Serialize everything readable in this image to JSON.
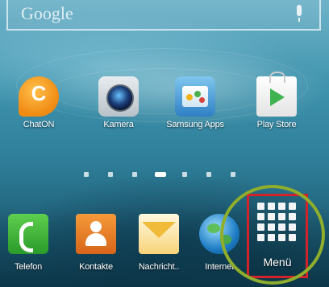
{
  "search": {
    "logo_text": "Google",
    "mic_icon": "microphone-icon"
  },
  "home_apps": [
    {
      "label": "ChatON",
      "icon": "chaton-icon"
    },
    {
      "label": "Kamera",
      "icon": "camera-icon"
    },
    {
      "label": "Samsung Apps",
      "icon": "samsung-apps-icon"
    },
    {
      "label": "Play Store",
      "icon": "play-store-icon"
    }
  ],
  "page_indicator": {
    "total_pages": 7,
    "current_page": 4
  },
  "dock": [
    {
      "label": "Telefon",
      "icon": "phone-icon"
    },
    {
      "label": "Kontakte",
      "icon": "contacts-icon"
    },
    {
      "label": "Nachricht..",
      "icon": "messages-icon"
    },
    {
      "label": "Internet",
      "icon": "internet-icon"
    },
    {
      "label": "Menü",
      "icon": "app-grid-icon"
    }
  ],
  "colors": {
    "menu_highlight": "#d2232a",
    "menu_circle": "#8fae2c"
  }
}
